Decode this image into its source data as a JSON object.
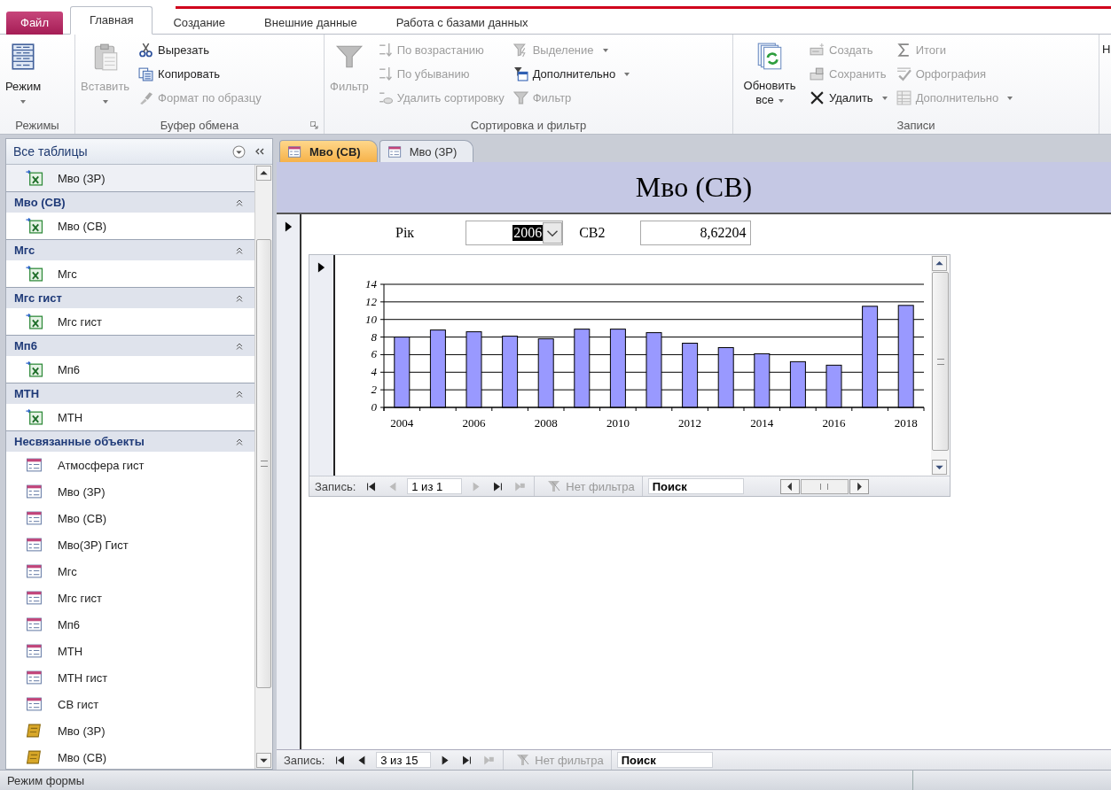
{
  "tabs": [
    {
      "label": "Файл",
      "kind": "file",
      "selected": false
    },
    {
      "label": "Главная",
      "kind": "tab",
      "selected": true
    },
    {
      "label": "Создание",
      "kind": "tab",
      "selected": false
    },
    {
      "label": "Внешние данные",
      "kind": "tab",
      "selected": false
    },
    {
      "label": "Работа с базами данных",
      "kind": "tab",
      "selected": false
    }
  ],
  "ribbon": {
    "groups": [
      {
        "label": "Режимы",
        "columns": [
          [
            {
              "label": "Режим",
              "kind": "large",
              "disabled": false,
              "dropdown": true
            }
          ]
        ]
      },
      {
        "label": "Буфер обмена",
        "launcher": true,
        "columns": [
          [
            {
              "label": "Вставить",
              "kind": "large",
              "disabled": true,
              "dropdown": true
            }
          ],
          [
            {
              "label": "Вырезать",
              "kind": "small",
              "disabled": false,
              "dropdown": false
            },
            {
              "label": "Копировать",
              "kind": "small",
              "disabled": false,
              "dropdown": false
            },
            {
              "label": "Формат по образцу",
              "kind": "small",
              "disabled": true,
              "dropdown": false
            }
          ]
        ]
      },
      {
        "label": "Сортировка и фильтр",
        "columns": [
          [
            {
              "label": "Фильтр",
              "kind": "large",
              "disabled": true,
              "dropdown": false
            }
          ],
          [
            {
              "label": "По возрастанию",
              "kind": "small",
              "disabled": true,
              "dropdown": false
            },
            {
              "label": "По убыванию",
              "kind": "small",
              "disabled": true,
              "dropdown": false
            },
            {
              "label": "Удалить сортировку",
              "kind": "small",
              "disabled": true,
              "dropdown": false
            }
          ],
          [
            {
              "label": "Выделение",
              "kind": "small",
              "disabled": true,
              "dropdown": true
            },
            {
              "label": "Дополнительно",
              "kind": "small",
              "disabled": false,
              "dropdown": true
            },
            {
              "label": "Фильтр",
              "kind": "small",
              "disabled": true,
              "dropdown": false
            }
          ]
        ]
      },
      {
        "label": "Записи",
        "columns": [
          [
            {
              "label": "Обновить все",
              "kind": "large",
              "disabled": false,
              "dropdown": true
            }
          ],
          [
            {
              "label": "Создать",
              "kind": "small",
              "disabled": true,
              "dropdown": false
            },
            {
              "label": "Сохранить",
              "kind": "small",
              "disabled": true,
              "dropdown": false
            },
            {
              "label": "Удалить",
              "kind": "small",
              "disabled": false,
              "dropdown": true
            }
          ],
          [
            {
              "label": "Итоги",
              "kind": "small",
              "disabled": true,
              "dropdown": false
            },
            {
              "label": "Орфография",
              "kind": "small",
              "disabled": true,
              "dropdown": false
            },
            {
              "label": "Дополнительно",
              "kind": "small",
              "disabled": true,
              "dropdown": true
            }
          ]
        ]
      },
      {
        "columns": [
          [
            {
              "label": "Н",
              "kind": "large",
              "disabled": false
            }
          ]
        ]
      }
    ]
  },
  "nav_pane": {
    "title": "Все таблицы",
    "groups": [
      {
        "items": [
          {
            "label": "Мво (ЗР)",
            "kind": "linked-table"
          }
        ]
      },
      {
        "header": "Мво (СВ)",
        "expanded": true,
        "items": [
          {
            "label": "Мво (СВ)",
            "kind": "linked-table"
          }
        ]
      },
      {
        "header": "Мгс",
        "expanded": true,
        "items": [
          {
            "label": "Мгс",
            "kind": "linked-table"
          }
        ]
      },
      {
        "header": "Мгс гист",
        "expanded": true,
        "items": [
          {
            "label": "Мгс гист",
            "kind": "linked-table"
          }
        ]
      },
      {
        "header": "Мп6",
        "expanded": true,
        "items": [
          {
            "label": "Мп6",
            "kind": "linked-table"
          }
        ]
      },
      {
        "header": "МТН",
        "expanded": true,
        "items": [
          {
            "label": "МТН",
            "kind": "linked-table"
          }
        ]
      },
      {
        "header": "Несвязанные объекты",
        "expanded": true,
        "items": [
          {
            "label": "Атмосфера гист",
            "kind": "form"
          },
          {
            "label": "Мво (ЗР)",
            "kind": "form"
          },
          {
            "label": "Мво (СВ)",
            "kind": "form"
          },
          {
            "label": "Мво(ЗР) Гист",
            "kind": "form"
          },
          {
            "label": "Мгс",
            "kind": "form"
          },
          {
            "label": "Мгс гист",
            "kind": "form"
          },
          {
            "label": "Мп6",
            "kind": "form"
          },
          {
            "label": "МТН",
            "kind": "form"
          },
          {
            "label": "МТН гист",
            "kind": "form"
          },
          {
            "label": "СВ гист",
            "kind": "form"
          },
          {
            "label": "Мво (ЗР)",
            "kind": "report"
          },
          {
            "label": "Мво (СВ)",
            "kind": "report"
          }
        ]
      }
    ]
  },
  "document_tabs": [
    {
      "label": "Мво (СВ)",
      "selected": true
    },
    {
      "label": "Мво (ЗР)",
      "selected": false
    }
  ],
  "form": {
    "title": "Мво (СВ)",
    "fields": [
      {
        "label": "Рік",
        "value": "2006",
        "kind": "combo",
        "highlighted": true
      },
      {
        "label": "СВ2",
        "value": "8,62204",
        "kind": "text",
        "highlighted": false
      }
    ],
    "subform": {
      "chart_data": {
        "type": "bar",
        "x": [
          2004,
          2005,
          2006,
          2007,
          2008,
          2009,
          2010,
          2011,
          2012,
          2013,
          2014,
          2015,
          2016,
          2017,
          2018
        ],
        "grid": true,
        "xlim": [
          2003.5,
          2018.5
        ],
        "series": [
          {
            "color": "#9999ff",
            "values": [
              8.0,
              8.8,
              8.6,
              8.1,
              7.8,
              8.9,
              8.9,
              8.5,
              7.3,
              6.8,
              6.1,
              5.2,
              4.8,
              11.5,
              11.6
            ]
          }
        ],
        "ylim": [
          0,
          14
        ],
        "yticks": [
          0,
          2,
          4,
          6,
          8,
          10,
          12,
          14
        ],
        "xticks": [
          2004,
          2006,
          2008,
          2010,
          2012,
          2014,
          2016,
          2018
        ]
      },
      "record_nav": {
        "label": "Запись:",
        "position": "1 из 1",
        "buttons": [
          {
            "disabled": false
          },
          {
            "disabled": true
          },
          {
            "disabled": true
          },
          {
            "disabled": false
          },
          {
            "disabled": true
          }
        ],
        "filter": "Нет фильтра",
        "search_placeholder": "Поиск"
      }
    },
    "record_nav": {
      "label": "Запись:",
      "position": "3 из 15",
      "buttons": [
        {
          "disabled": false
        },
        {
          "disabled": false
        },
        {
          "disabled": false
        },
        {
          "disabled": false
        },
        {
          "disabled": true
        }
      ],
      "filter": "Нет фильтра",
      "search_placeholder": "Поиск"
    }
  },
  "status_bar": {
    "text": "Режим формы"
  }
}
